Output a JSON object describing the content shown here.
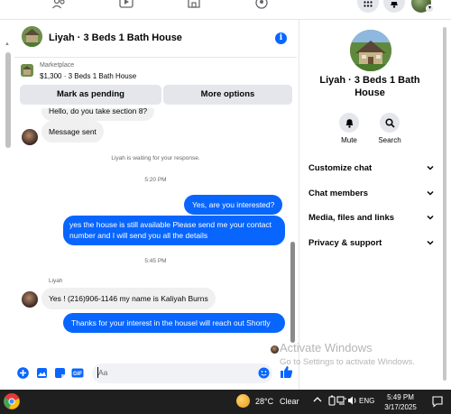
{
  "conversation": {
    "title": "Liyah · 3 Beds 1 Bath House",
    "info_icon": "info-icon"
  },
  "marketplace": {
    "label": "Marketplace",
    "listing": "$1,300 · 3 Beds 1 Bath House",
    "mark_pending_label": "Mark as pending",
    "more_options_label": "More options"
  },
  "messages": {
    "partial_top": "Hello, do you take section 8?",
    "message_sent": "Message sent",
    "waiting_text": "Liyah is waiting for your response.",
    "time1": "5:20 PM",
    "out1": "Yes, are you interested?",
    "out2": "yes the house is still available Please send me your contact number and I will send you all the details",
    "time2": "5:45 PM",
    "sender_name": "Liyah",
    "in1": "Yes ! (216)906-1146 my name is Kaliyah Burns",
    "out3": "Thanks for your interest in the housel will reach out Shortly"
  },
  "composer": {
    "placeholder": "Aa"
  },
  "right_panel": {
    "title": "Liyah · 3 Beds 1 Bath House",
    "mute_label": "Mute",
    "search_label": "Search",
    "sections": [
      "Customize chat",
      "Chat members",
      "Media, files and links",
      "Privacy & support"
    ]
  },
  "watermark": {
    "line1": "Activate Windows",
    "line2": "Go to Settings to activate Windows."
  },
  "taskbar": {
    "temperature": "28°C",
    "condition": "Clear",
    "language": "ENG",
    "time": "5:49 PM",
    "date": "3/17/2025"
  },
  "colors": {
    "accent": "#0866ff",
    "bubble_in": "#f0f0f0",
    "taskbar": "#1f1f1f"
  }
}
